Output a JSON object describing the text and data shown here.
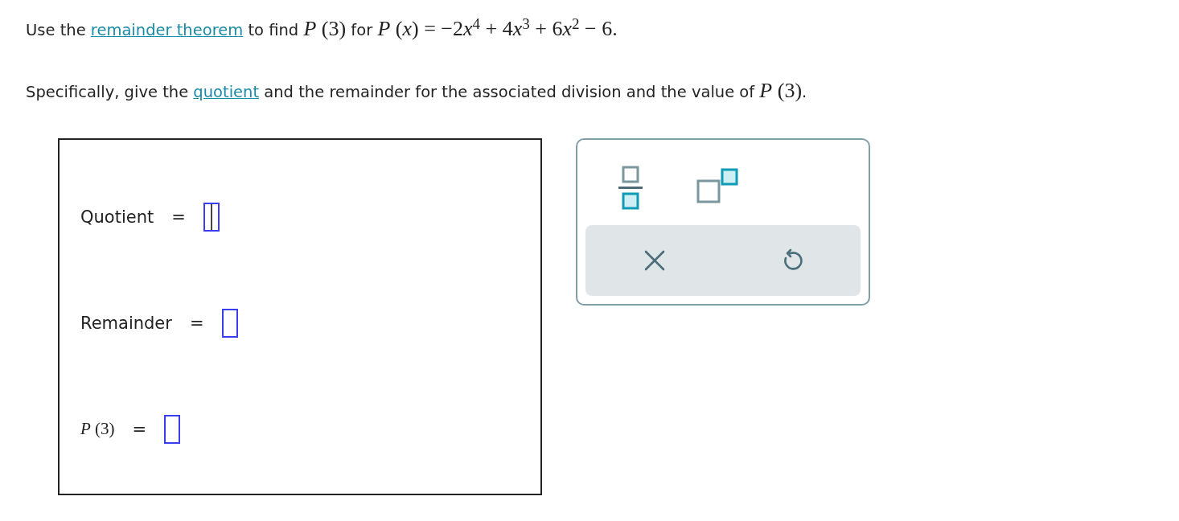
{
  "question": [
    [
      {
        "kind": "text",
        "text": "Use the "
      },
      {
        "kind": "link",
        "text": "remainder theorem"
      },
      {
        "kind": "text",
        "text": " to find "
      },
      {
        "kind": "math",
        "text": "*P* (3)"
      },
      {
        "kind": "text",
        "text": " for "
      },
      {
        "kind": "math",
        "text": "*P* (*x*) = −2"
      },
      {
        "kind": "var",
        "text": "x"
      },
      {
        "kind": "sup",
        "text": "4"
      },
      {
        "kind": "math",
        "text": " + 4"
      },
      {
        "kind": "var",
        "text": "x"
      },
      {
        "kind": "sup",
        "text": "3"
      },
      {
        "kind": "math",
        "text": " + 6"
      },
      {
        "kind": "var",
        "text": "x"
      },
      {
        "kind": "sup",
        "text": "2"
      },
      {
        "kind": "math",
        "text": " − 6."
      }
    ],
    [
      {
        "kind": "text",
        "text": "Specifically, give the "
      },
      {
        "kind": "link",
        "text": "quotient"
      },
      {
        "kind": "text",
        "text": " and the remainder for the associated division and the value of "
      },
      {
        "kind": "math",
        "text": "*P* (3)"
      },
      {
        "kind": "text",
        "text": "."
      }
    ]
  ],
  "answers": [
    {
      "kind": "text",
      "label": "Quotient",
      "equals": "=",
      "focused": true
    },
    {
      "kind": "text",
      "label": "Remainder",
      "equals": "=",
      "focused": false
    },
    {
      "kind": "math",
      "label": "*P* (3)",
      "equals": "=",
      "focused": false
    }
  ]
}
